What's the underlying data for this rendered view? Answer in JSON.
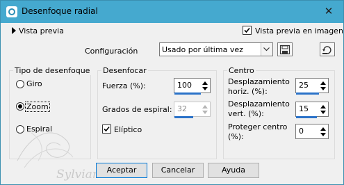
{
  "window": {
    "title": "Desenfoque radial",
    "close_glyph": "✕"
  },
  "preview": {
    "toggle_label": "Vista previa",
    "image_preview_label": "Vista previa en imagen",
    "image_preview_checked": true
  },
  "config": {
    "label": "Configuración",
    "value": "Usado por última vez"
  },
  "blur_type": {
    "title": "Tipo de desenfoque",
    "options": [
      {
        "label": "Giro",
        "selected": false
      },
      {
        "label": "Zoom",
        "selected": true
      },
      {
        "label": "Espiral",
        "selected": false
      }
    ]
  },
  "blur": {
    "title": "Desenfocar",
    "strength_label": "Fuerza (%):",
    "strength_value": "100",
    "spiral_label": "Grados de espiral:",
    "spiral_value": "32",
    "spiral_enabled": false,
    "elliptic_label": "Elíptico",
    "elliptic_checked": true
  },
  "center": {
    "title": "Centro",
    "horiz_label_line1": "Desplazamiento",
    "horiz_label_line2": "horiz. (%):",
    "horiz_value": "25",
    "vert_label_line1": "Desplazamiento",
    "vert_label_line2": "vert. (%):",
    "vert_value": "15",
    "protect_label_line1": "Proteger centro",
    "protect_label_line2": "(%):",
    "protect_value": "0"
  },
  "buttons": {
    "accept": "Aceptar",
    "cancel": "Cancelar",
    "help": "Ayuda"
  },
  "watermark": {
    "text": "Sylviane"
  },
  "colors": {
    "titlebar": "#45a9cf",
    "accent_blue": "#2a72c8",
    "default_button_border": "#0078d7"
  },
  "icons": [
    "app-icon",
    "close-icon",
    "expand-triangle-icon",
    "check-icon",
    "dropdown-arrow-icon",
    "save-disk-icon",
    "reset-icon",
    "spin-up-icon",
    "spin-down-icon"
  ]
}
